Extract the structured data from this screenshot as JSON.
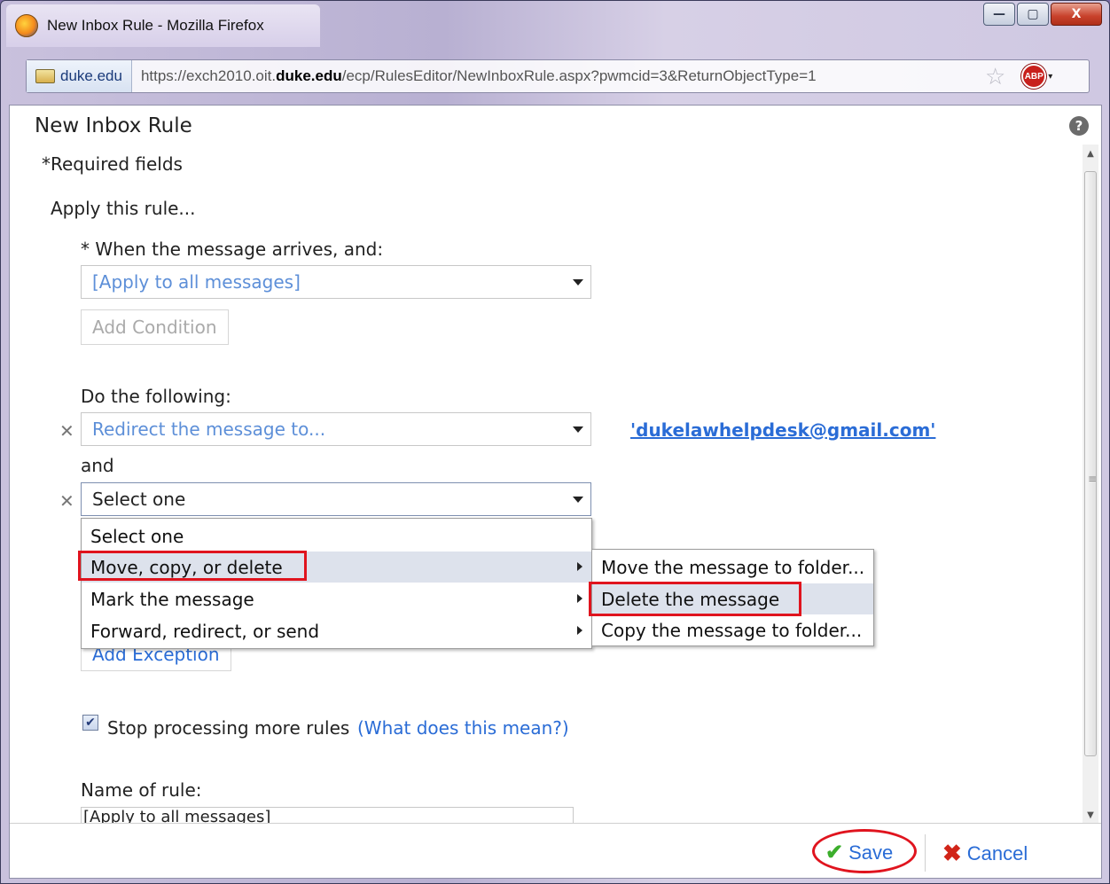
{
  "window": {
    "title": "New Inbox Rule - Mozilla Firefox",
    "controls": {
      "minimize": "—",
      "maximize": "▢",
      "close": "X"
    }
  },
  "urlbar": {
    "site": "duke.edu",
    "url_prefix": "https://exch2010.oit.",
    "url_domain": "duke.edu",
    "url_suffix": "/ecp/RulesEditor/NewInboxRule.aspx?pwmcid=3&ReturnObjectType=1",
    "abp": "ABP"
  },
  "page": {
    "title": "New Inbox Rule",
    "help": "?",
    "required": "*Required fields",
    "apply_heading": "Apply this rule...",
    "when_label": "* When the message arrives, and:",
    "when_value": "[Apply to all messages]",
    "add_condition": "Add Condition",
    "do_label": "Do the following:",
    "action1_value": "Redirect the message to...",
    "action1_target": "'dukelawhelpdesk@gmail.com'",
    "and_label": "and",
    "action2_value": "Select one",
    "add_exception": "Add Exception",
    "stop_label": "Stop processing more rules",
    "stop_help": "(What does this mean?)",
    "name_label": "Name of rule:",
    "name_value": "[Apply to all messages]"
  },
  "menu": {
    "items": [
      {
        "label": "Select one"
      },
      {
        "label": "Move, copy, or delete"
      },
      {
        "label": "Mark the message"
      },
      {
        "label": "Forward, redirect, or send"
      }
    ]
  },
  "submenu": {
    "items": [
      {
        "label": "Move the message to folder..."
      },
      {
        "label": "Delete the message"
      },
      {
        "label": "Copy the message to folder..."
      }
    ]
  },
  "footer": {
    "save": "Save",
    "cancel": "Cancel"
  },
  "icons": [
    "firefox-icon",
    "site-identity-icon",
    "bookmark-star-icon",
    "adblock-plus-icon",
    "help-icon",
    "remove-action-icon",
    "dropdown-arrow-icon",
    "submenu-arrow-icon",
    "checkbox-check-icon",
    "save-check-icon",
    "cancel-x-icon"
  ],
  "colors": {
    "link": "#2a6cd6",
    "placeholder_blue": "#5d8fd8",
    "highlight": "#e0141e",
    "menu_hover": "#dde2ec"
  }
}
